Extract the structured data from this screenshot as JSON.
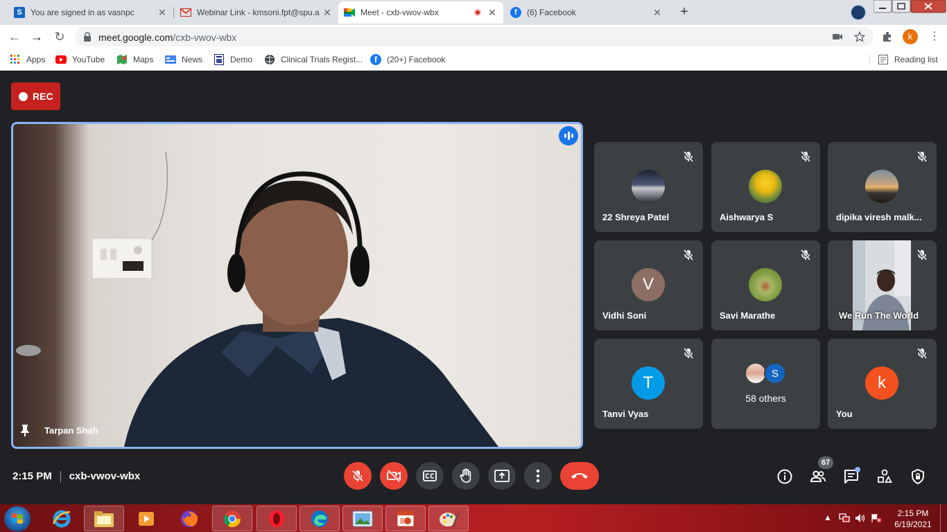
{
  "browser": {
    "tabs": [
      {
        "title": "You are signed in as vasnpc",
        "favicon": "s-icon",
        "active": false
      },
      {
        "title": "Webinar Link - kmsoni.fpt@spu.a",
        "favicon": "gmail-icon",
        "active": false
      },
      {
        "title": "Meet - cxb-vwov-wbx",
        "favicon": "meet-icon",
        "active": true,
        "recording": true
      },
      {
        "title": "(6) Facebook",
        "favicon": "facebook-icon",
        "active": false
      }
    ],
    "new_tab": "+",
    "url_host": "meet.google.com",
    "url_path": "/cxb-vwov-wbx",
    "profile_initial": "k",
    "bookmarks": [
      {
        "label": "Apps",
        "icon": "apps-grid-icon"
      },
      {
        "label": "YouTube",
        "icon": "youtube-icon"
      },
      {
        "label": "Maps",
        "icon": "maps-icon"
      },
      {
        "label": "News",
        "icon": "news-icon"
      },
      {
        "label": "Demo",
        "icon": "demo-icon"
      },
      {
        "label": "Clinical Trials Regist...",
        "icon": "globe-icon"
      },
      {
        "label": "(20+) Facebook",
        "icon": "facebook-icon"
      }
    ],
    "reading_list": "Reading list"
  },
  "meet": {
    "rec_label": "REC",
    "main_speaker": "Tarpan Shah",
    "participants": [
      {
        "name": "22 Shreya Patel",
        "avatar": "photo",
        "muted": true
      },
      {
        "name": "Aishwarya S",
        "avatar": "photo",
        "muted": true
      },
      {
        "name": "dipika viresh malk...",
        "avatar": "photo",
        "muted": true
      },
      {
        "name": "Vidhi Soni",
        "avatar": "V",
        "avatar_color": "#8d6e63",
        "muted": true
      },
      {
        "name": "Savi Marathe",
        "avatar": "photo",
        "muted": true
      },
      {
        "name": "We Run The World",
        "avatar": "video",
        "muted": true
      },
      {
        "name": "Tanvi Vyas",
        "avatar": "T",
        "avatar_color": "#039be5",
        "muted": true
      },
      {
        "name": "58 others",
        "avatar": "group",
        "group_initial": "S"
      },
      {
        "name": "You",
        "avatar": "k",
        "avatar_color": "#f4511e",
        "muted": true
      }
    ],
    "time": "2:15 PM",
    "meeting_code": "cxb-vwov-wbx",
    "people_count": "67",
    "accent_color": "#8ab4f8",
    "hangup_color": "#ea4335"
  },
  "taskbar": {
    "time": "2:15 PM",
    "date": "6/19/2021",
    "apps": [
      "ie-icon",
      "explorer-icon",
      "media-player-icon",
      "firefox-icon",
      "chrome-icon",
      "opera-icon",
      "edge-icon",
      "photo-viewer-icon",
      "powerpoint-icon",
      "paint-icon"
    ]
  }
}
